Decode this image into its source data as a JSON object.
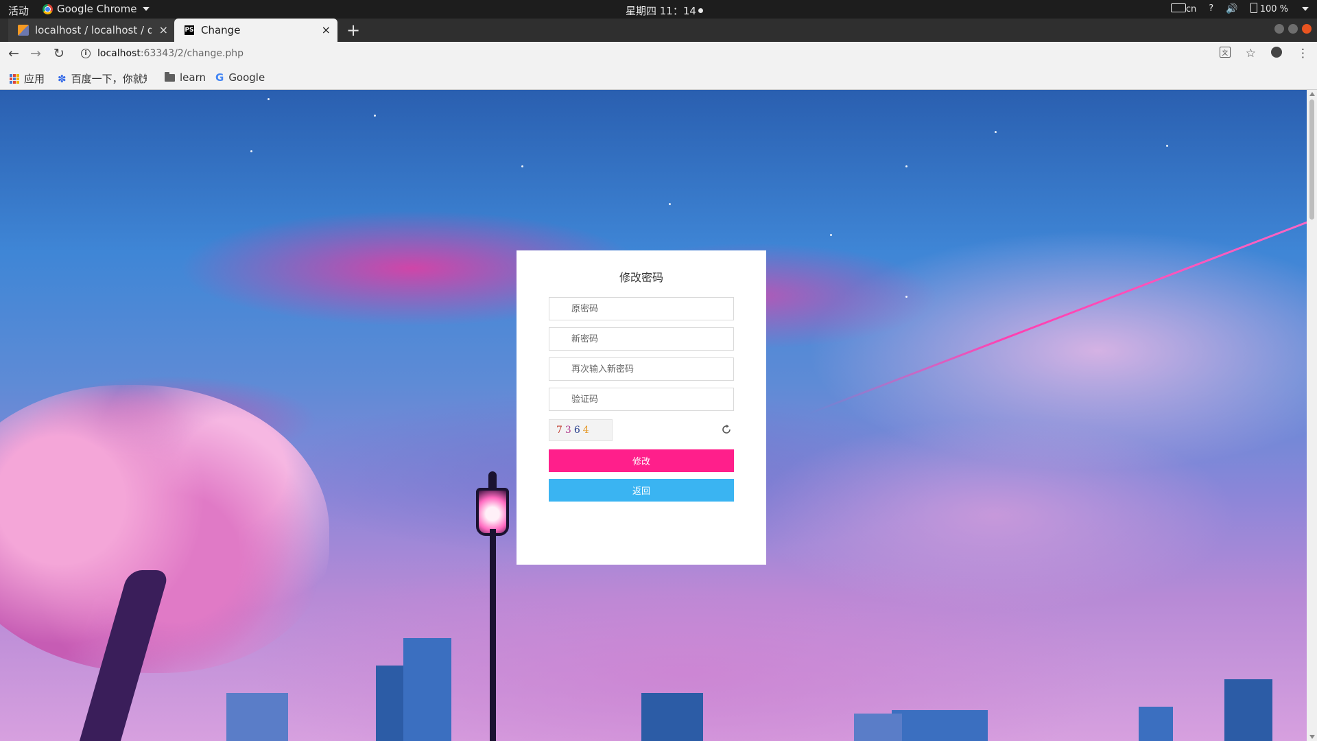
{
  "os_panel": {
    "activities": "活动",
    "app_name": "Google Chrome",
    "clock": "星期四 11：14",
    "input_method": "cn",
    "help": "?",
    "battery": "100 %"
  },
  "browser": {
    "tabs": [
      {
        "label": "localhost / localhost / dat",
        "icon": "phpmyadmin-icon",
        "active": false
      },
      {
        "label": "Change",
        "icon": "phpstorm-icon",
        "active": true
      }
    ],
    "new_tab": "+",
    "close_glyph": "×",
    "url_host": "localhost",
    "url_rest": ":63343/2/change.php",
    "bookmarks": [
      {
        "label": "应用",
        "icon": "apps-grid-icon"
      },
      {
        "label": "百度一下，你就知道",
        "icon": "baidu-paw-icon"
      },
      {
        "label": "learn",
        "icon": "folder-icon"
      },
      {
        "label": "Google",
        "icon": "google-icon"
      }
    ]
  },
  "form": {
    "title": "修改密码",
    "fields": [
      {
        "placeholder": "原密码",
        "type": "password"
      },
      {
        "placeholder": "新密码",
        "type": "password"
      },
      {
        "placeholder": "再次输入新密码",
        "type": "password"
      },
      {
        "placeholder": "验证码",
        "type": "text"
      }
    ],
    "captcha": [
      "7",
      "3",
      "6",
      "4"
    ],
    "submit_label": "修改",
    "back_label": "返回",
    "colors": {
      "submit": "#ff1f8b",
      "back": "#3ab4f2"
    }
  }
}
